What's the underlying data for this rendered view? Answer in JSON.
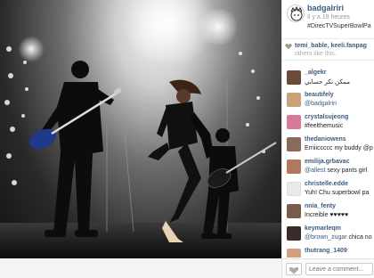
{
  "post": {
    "username": "badgalriri",
    "time": "Il y a 19 heures",
    "caption": "#DirecTVSuperBowlPa"
  },
  "likes": {
    "likers": "temi_bable, keeli.fanpag",
    "others": "others like this."
  },
  "comments": [
    {
      "user": "_algekr",
      "text": "ممكن نكر حسابي",
      "mention": "",
      "color": "#6b4a3a"
    },
    {
      "user": "beautifely",
      "text": "",
      "mention": "@badgalriri",
      "color": "#c9a27a"
    },
    {
      "user": "crystalsujeong",
      "text": "#feelthemusic",
      "mention": "",
      "color": "#d77a9a"
    },
    {
      "user": "thedaniowens",
      "text": "Erriiiccccc my buddy @p",
      "mention": "",
      "color": "#8a6a5a"
    },
    {
      "user": "emilija.grbavac",
      "text": "",
      "mention": "@allest",
      "text_after": " sexy pants girl",
      "color": "#b07a5a"
    },
    {
      "user": "christelle.edde",
      "text": "Yuh! Chu superbowl pa",
      "mention": "",
      "color": "#e9e9e9"
    },
    {
      "user": "nnia_fenty",
      "text": "Increible ♥♥♥♥♥",
      "mention": "",
      "color": "#7a5a4a"
    },
    {
      "user": "keymarleqm",
      "text": "",
      "mention": "@brown_zugar",
      "text_after": " chica no",
      "color": "#3a2a2a"
    },
    {
      "user": "thutrang_1409",
      "text": "",
      "mention": "",
      "color": "#d0a080"
    }
  ],
  "footer": {
    "comment_placeholder": "Leave a comment..."
  },
  "icons": {
    "heart": "heart-icon",
    "avatar": "avatar-icon"
  }
}
